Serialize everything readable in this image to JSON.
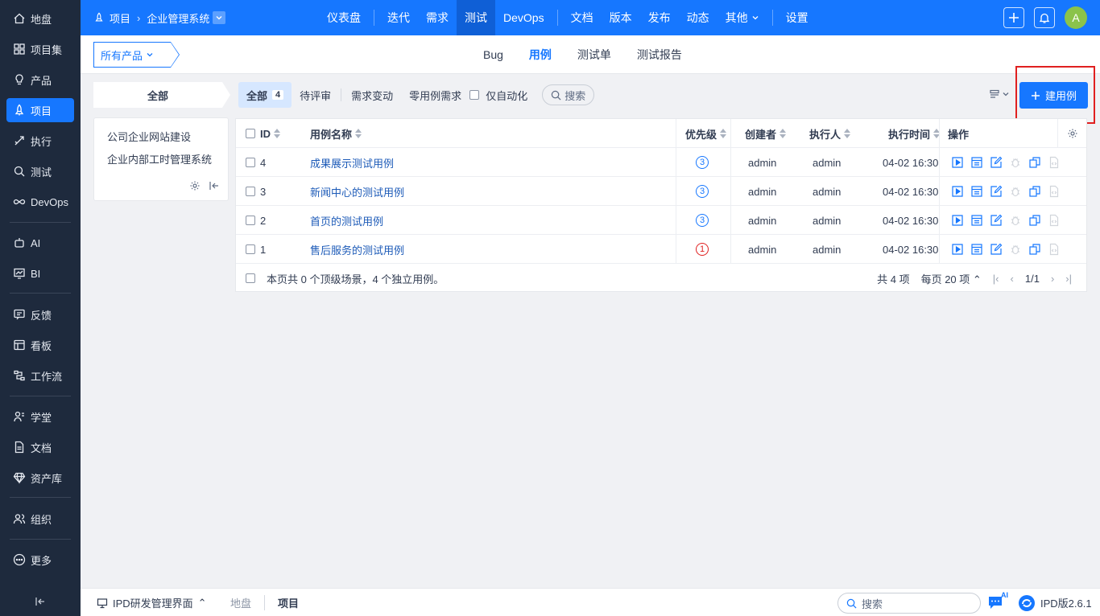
{
  "sidebar": {
    "items": [
      {
        "label": "地盘",
        "icon": "home-icon"
      },
      {
        "label": "项目集",
        "icon": "grid-icon"
      },
      {
        "label": "产品",
        "icon": "bulb-icon"
      },
      {
        "label": "项目",
        "icon": "rocket-icon"
      },
      {
        "label": "执行",
        "icon": "run-icon"
      },
      {
        "label": "测试",
        "icon": "search-bug-icon"
      },
      {
        "label": "DevOps",
        "icon": "infinity-icon"
      },
      {
        "label": "AI",
        "icon": "robot-icon"
      },
      {
        "label": "BI",
        "icon": "chart-icon"
      },
      {
        "label": "反馈",
        "icon": "feedback-icon"
      },
      {
        "label": "看板",
        "icon": "kanban-icon"
      },
      {
        "label": "工作流",
        "icon": "workflow-icon"
      },
      {
        "label": "学堂",
        "icon": "school-icon"
      },
      {
        "label": "文档",
        "icon": "doc-icon"
      },
      {
        "label": "资产库",
        "icon": "diamond-icon"
      },
      {
        "label": "组织",
        "icon": "people-icon"
      },
      {
        "label": "更多",
        "icon": "more-icon"
      }
    ]
  },
  "topbar": {
    "crumb_root": "项目",
    "crumb_project": "企业管理系统",
    "nav": [
      "仪表盘",
      "迭代",
      "需求",
      "测试",
      "DevOps",
      "文档",
      "版本",
      "发布",
      "动态",
      "其他",
      "设置"
    ],
    "avatar": "A"
  },
  "subhead": {
    "product_select": "所有产品",
    "tabs": [
      "Bug",
      "用例",
      "测试单",
      "测试报告"
    ]
  },
  "modules": {
    "all_label": "全部",
    "items": [
      "公司企业网站建设",
      "企业内部工时管理系统"
    ]
  },
  "filter": {
    "all_label": "全部",
    "all_count": "4",
    "review": "待评审",
    "changed": "需求变动",
    "zero_case": "零用例需求",
    "auto_only": "仅自动化",
    "search": "搜索"
  },
  "create_button": "建用例",
  "table": {
    "headers": {
      "id": "ID",
      "title": "用例名称",
      "pri": "优先级",
      "creator": "创建者",
      "executor": "执行人",
      "exec_time": "执行时间",
      "actions": "操作"
    },
    "rows": [
      {
        "id": "4",
        "title": "成果展示测试用例",
        "pri": "3",
        "creator": "admin",
        "executor": "admin",
        "time": "04-02 16:30"
      },
      {
        "id": "3",
        "title": "新闻中心的测试用例",
        "pri": "3",
        "creator": "admin",
        "executor": "admin",
        "time": "04-02 16:30"
      },
      {
        "id": "2",
        "title": "首页的测试用例",
        "pri": "3",
        "creator": "admin",
        "executor": "admin",
        "time": "04-02 16:30"
      },
      {
        "id": "1",
        "title": "售后服务的测试用例",
        "pri": "1",
        "creator": "admin",
        "executor": "admin",
        "time": "04-02 16:30"
      }
    ],
    "summary": "本页共 0 个顶级场景，4 个独立用例。",
    "total": "共 4 项",
    "per_page": "每页 20 项",
    "page": "1/1"
  },
  "bottombar": {
    "ipd_label": "IPD研发管理界面",
    "crumbs": [
      "地盘",
      "项目"
    ],
    "search": "搜索",
    "ai_badge": "AI",
    "version": "IPD版2.6.1"
  },
  "colors": {
    "primary": "#1677ff",
    "sidebar": "#1e2a3d",
    "highlight": "#e02020"
  }
}
